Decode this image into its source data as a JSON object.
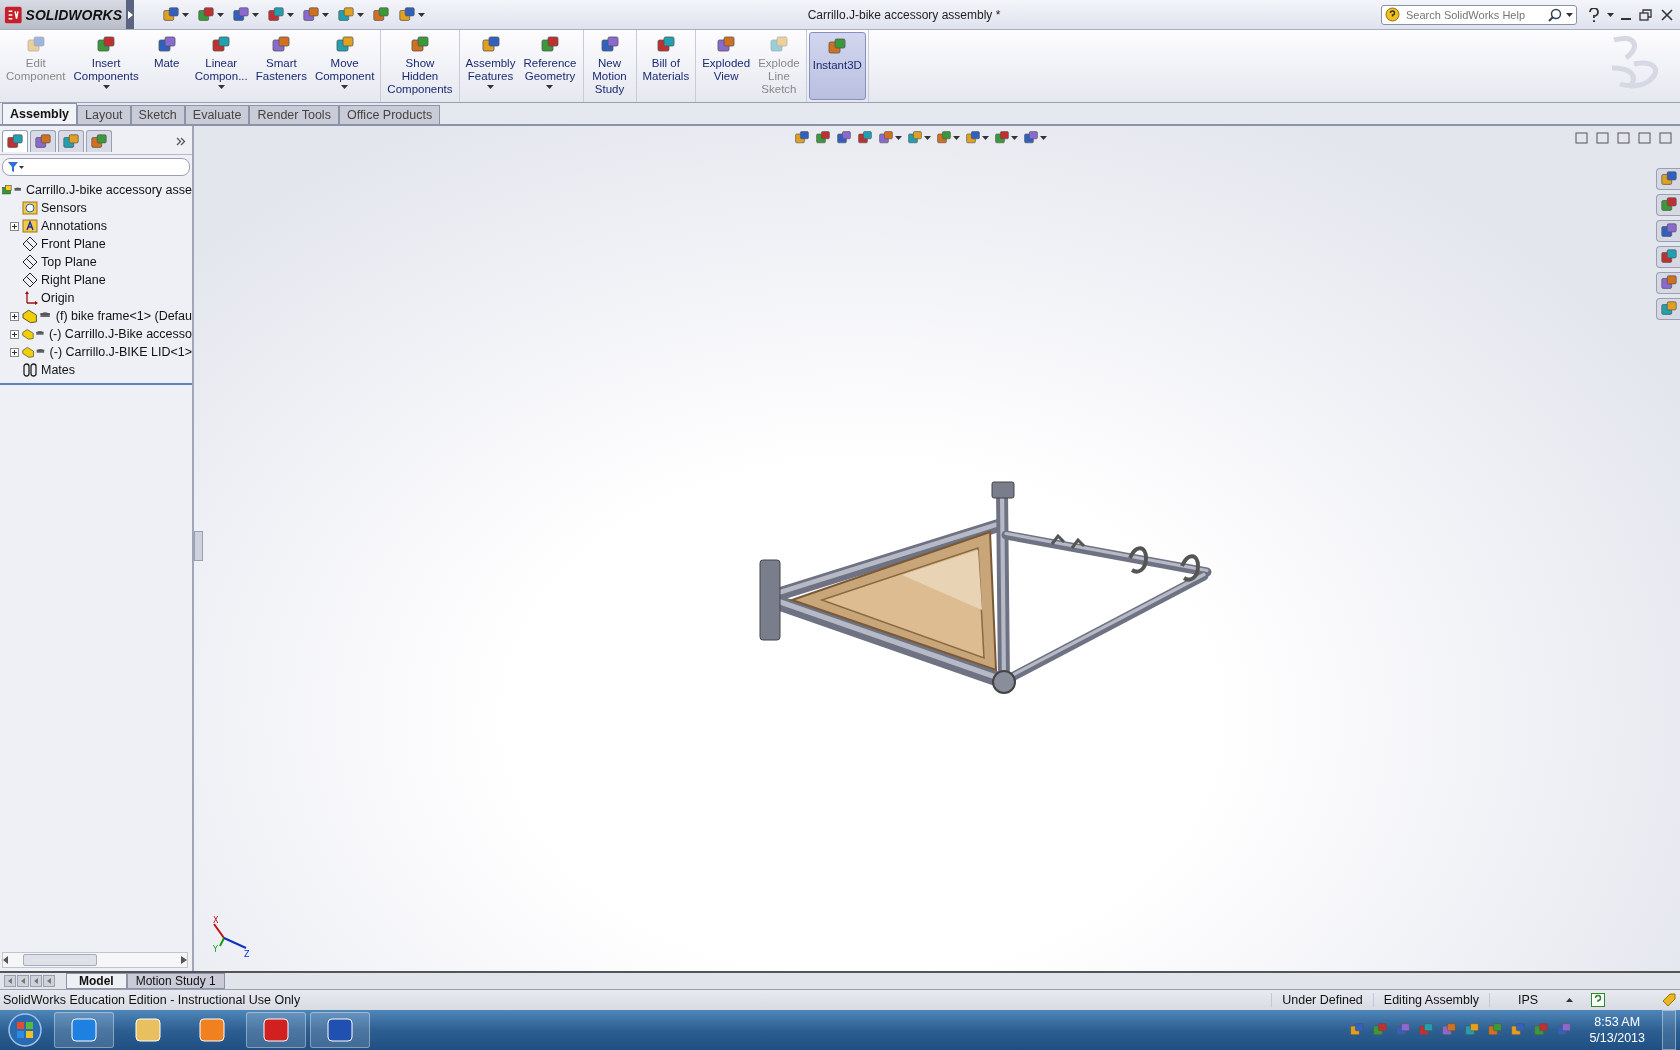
{
  "window": {
    "logo": "SOLIDWORKS",
    "title": "Carrillo.J-bike accessory assembly *",
    "search": {
      "placeholder": "Search SolidWorks Help"
    }
  },
  "command_groups": [
    [
      {
        "label": "Edit\nComponent",
        "disabled": true,
        "dropdown": false,
        "selected": false
      },
      {
        "label": "Insert\nComponents",
        "disabled": false,
        "dropdown": true,
        "selected": false
      },
      {
        "label": "Mate",
        "disabled": false,
        "dropdown": false,
        "selected": false
      },
      {
        "label": "Linear\nCompon...",
        "disabled": false,
        "dropdown": true,
        "selected": false
      },
      {
        "label": "Smart\nFasteners",
        "disabled": false,
        "dropdown": false,
        "selected": false
      },
      {
        "label": "Move\nComponent",
        "disabled": false,
        "dropdown": true,
        "selected": false
      }
    ],
    [
      {
        "label": "Show\nHidden\nComponents",
        "disabled": false,
        "dropdown": false,
        "selected": false
      }
    ],
    [
      {
        "label": "Assembly\nFeatures",
        "disabled": false,
        "dropdown": true,
        "selected": false
      },
      {
        "label": "Reference\nGeometry",
        "disabled": false,
        "dropdown": true,
        "selected": false
      }
    ],
    [
      {
        "label": "New\nMotion\nStudy",
        "disabled": false,
        "dropdown": false,
        "selected": false
      }
    ],
    [
      {
        "label": "Bill of\nMaterials",
        "disabled": false,
        "dropdown": false,
        "selected": false
      }
    ],
    [
      {
        "label": "Exploded\nView",
        "disabled": false,
        "dropdown": false,
        "selected": false
      },
      {
        "label": "Explode\nLine\nSketch",
        "disabled": true,
        "dropdown": false,
        "selected": false
      }
    ],
    [
      {
        "label": "Instant3D",
        "disabled": false,
        "dropdown": false,
        "selected": true
      }
    ]
  ],
  "tabs": [
    {
      "label": "Assembly",
      "selected": true
    },
    {
      "label": "Layout",
      "selected": false
    },
    {
      "label": "Sketch",
      "selected": false
    },
    {
      "label": "Evaluate",
      "selected": false
    },
    {
      "label": "Render Tools",
      "selected": false
    },
    {
      "label": "Office Products",
      "selected": false
    }
  ],
  "tree": {
    "label": "Carrillo.J-bike accessory asse",
    "kind": "assembly",
    "children": [
      {
        "label": "Sensors",
        "kind": "sensors"
      },
      {
        "label": "Annotations",
        "kind": "annotations",
        "expanded": false
      },
      {
        "label": "Front Plane",
        "kind": "plane"
      },
      {
        "label": "Top Plane",
        "kind": "plane"
      },
      {
        "label": "Right Plane",
        "kind": "plane"
      },
      {
        "label": "Origin",
        "kind": "origin"
      },
      {
        "label": "(f) bike frame<1> (Defau",
        "kind": "component",
        "expanded": false
      },
      {
        "label": "(-) Carrillo.J-Bike accesso",
        "kind": "component",
        "expanded": false
      },
      {
        "label": "(-) Carrillo.J-BIKE LID<1>",
        "kind": "component",
        "expanded": false
      },
      {
        "label": "Mates",
        "kind": "mates"
      }
    ]
  },
  "panel_tabs": [
    {
      "selected": true
    },
    {
      "selected": false
    },
    {
      "selected": false
    },
    {
      "selected": false
    }
  ],
  "triad": [
    "X",
    "Y",
    "Z"
  ],
  "bottom_tabs": [
    {
      "label": "Model",
      "selected": true
    },
    {
      "label": "Motion Study 1",
      "selected": false
    }
  ],
  "status_bar": {
    "message": "SolidWorks Education Edition - Instructional Use Only",
    "fields": [
      "Under Defined",
      "Editing Assembly",
      "IPS"
    ]
  },
  "taskbar": {
    "time": "8:53 AM",
    "date": "5/13/2013"
  }
}
